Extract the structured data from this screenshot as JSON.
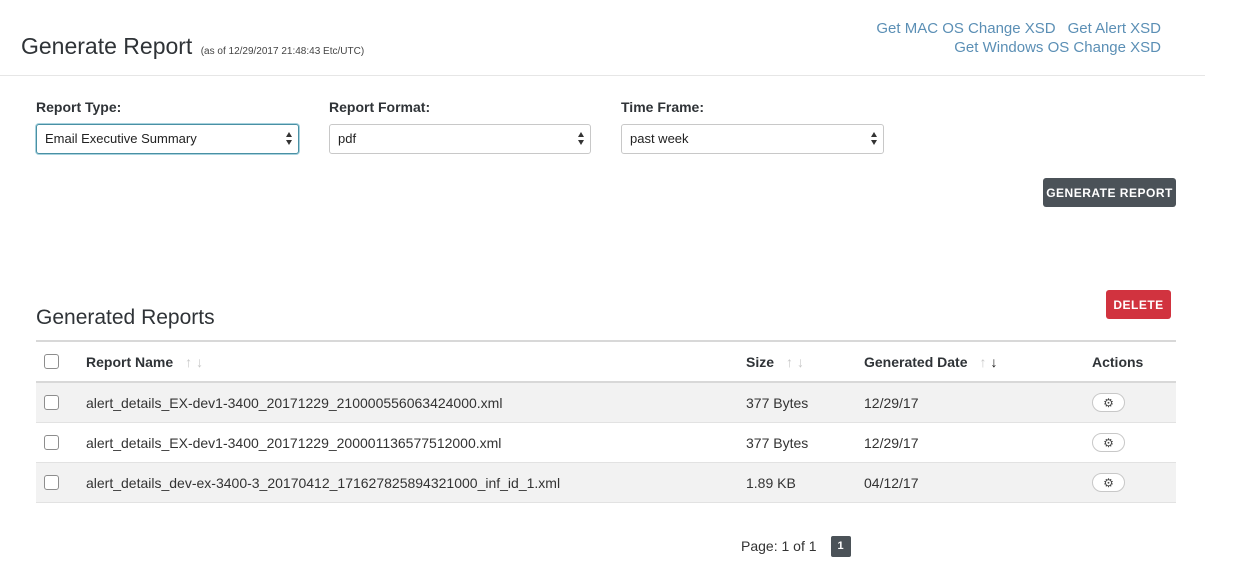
{
  "header": {
    "title": "Generate Report",
    "as_of": "(as of 12/29/2017 21:48:43 Etc/UTC)",
    "links": {
      "mac_xsd": "Get MAC OS Change XSD",
      "alert_xsd": "Get Alert XSD",
      "windows_xsd": "Get Windows OS Change XSD"
    },
    "link_color": "#5b8fb5"
  },
  "form": {
    "report_type": {
      "label": "Report Type:",
      "value": "Email Executive Summary"
    },
    "report_format": {
      "label": "Report Format:",
      "value": "pdf"
    },
    "time_frame": {
      "label": "Time Frame:",
      "value": "past week"
    },
    "generate_label": "GENERATE REPORT"
  },
  "reports": {
    "title": "Generated Reports",
    "delete_label": "DELETE",
    "columns": {
      "name": "Report Name",
      "size": "Size",
      "date": "Generated Date",
      "actions": "Actions"
    },
    "sort_icons": {
      "up": "↑",
      "down": "↓"
    },
    "rows": [
      {
        "name": "alert_details_EX-dev1-3400_20171229_210000556063424000.xml",
        "size": "377 Bytes",
        "date": "12/29/17"
      },
      {
        "name": "alert_details_EX-dev1-3400_20171229_200001136577512000.xml",
        "size": "377 Bytes",
        "date": "12/29/17"
      },
      {
        "name": "alert_details_dev-ex-3400-3_20170412_171627825894321000_inf_id_1.xml",
        "size": "1.89 KB",
        "date": "04/12/17"
      }
    ],
    "action_icon": "gear-icon",
    "gear_glyph": "⚙"
  },
  "pagination": {
    "label": "Page: 1 of 1",
    "current": "1"
  },
  "colors": {
    "primary_button": "#4b5258",
    "danger_button": "#d1333f"
  }
}
